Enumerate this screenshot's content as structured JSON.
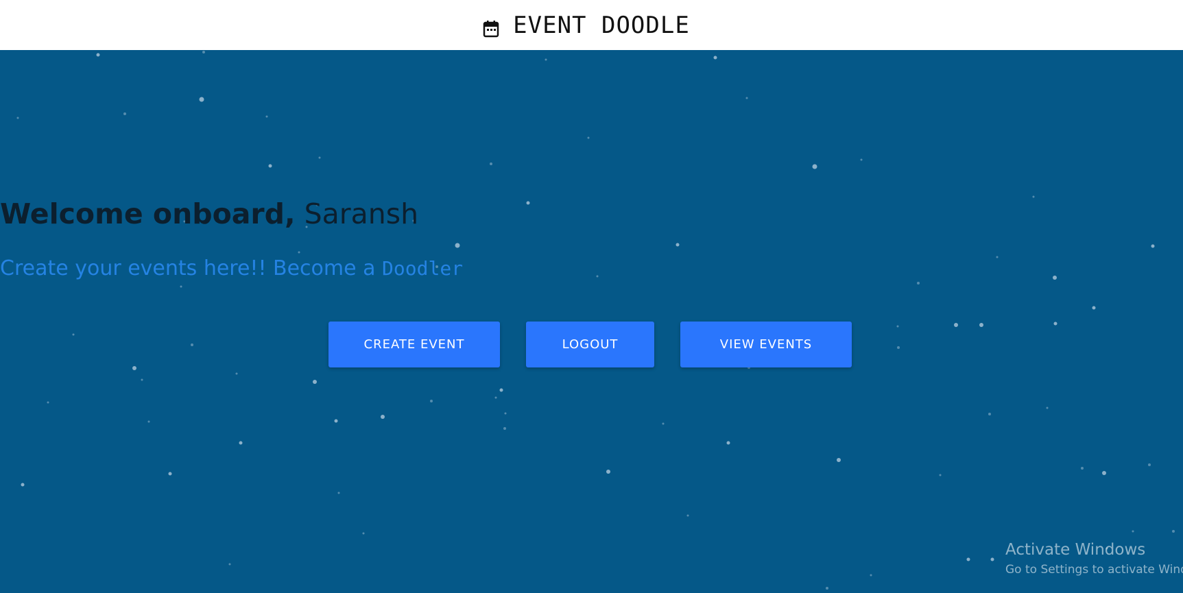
{
  "header": {
    "brand_icon": "calendar-icon",
    "title": "EVENT DOODLE"
  },
  "hero": {
    "welcome_bold": "Welcome onboard,",
    "welcome_name": "Saransh",
    "tagline_text": "Create your events here!! Become a",
    "tagline_mono": "Doodler"
  },
  "actions": {
    "create_label": "CREATE EVENT",
    "logout_label": "LOGOUT",
    "view_label": "VIEW EVENTS"
  },
  "watermark": {
    "title": "Activate Windows",
    "subtitle": "Go to Settings to activate Windows."
  },
  "colors": {
    "background": "#055888",
    "header": "#ffffff",
    "button": "#2a76fd",
    "tagline": "#2583e3",
    "particles": "#b9cfe0"
  },
  "background_effect": "particles"
}
